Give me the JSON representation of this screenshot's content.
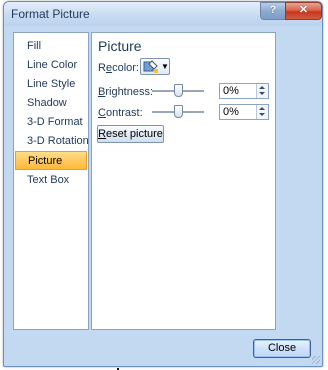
{
  "window": {
    "title": "Format Picture"
  },
  "titlebar": {
    "help_label": "?",
    "close_label": "✕"
  },
  "nav": {
    "items": [
      {
        "label": "Fill"
      },
      {
        "label": "Line Color"
      },
      {
        "label": "Line Style"
      },
      {
        "label": "Shadow"
      },
      {
        "label": "3-D Format"
      },
      {
        "label": "3-D Rotation"
      },
      {
        "label": "Picture",
        "active": true
      },
      {
        "label": "Text Box"
      }
    ]
  },
  "content": {
    "heading": "Picture",
    "recolor": {
      "label_pre": "R",
      "label_u": "e",
      "label_post": "color:",
      "icon": "recolor-icon"
    },
    "brightness": {
      "label_u": "B",
      "label_post": "rightness:",
      "value": "0%",
      "level": 0.5
    },
    "contrast": {
      "label_u": "C",
      "label_post": "ontrast:",
      "value": "0%",
      "level": 0.5
    },
    "reset": {
      "label_u": "R",
      "label_post": "eset picture"
    }
  },
  "footer": {
    "close_label": "Close"
  },
  "colors": {
    "active_item": "#ffc960",
    "window_bg": "#c3d8f1",
    "title_text": "#1e395b"
  }
}
